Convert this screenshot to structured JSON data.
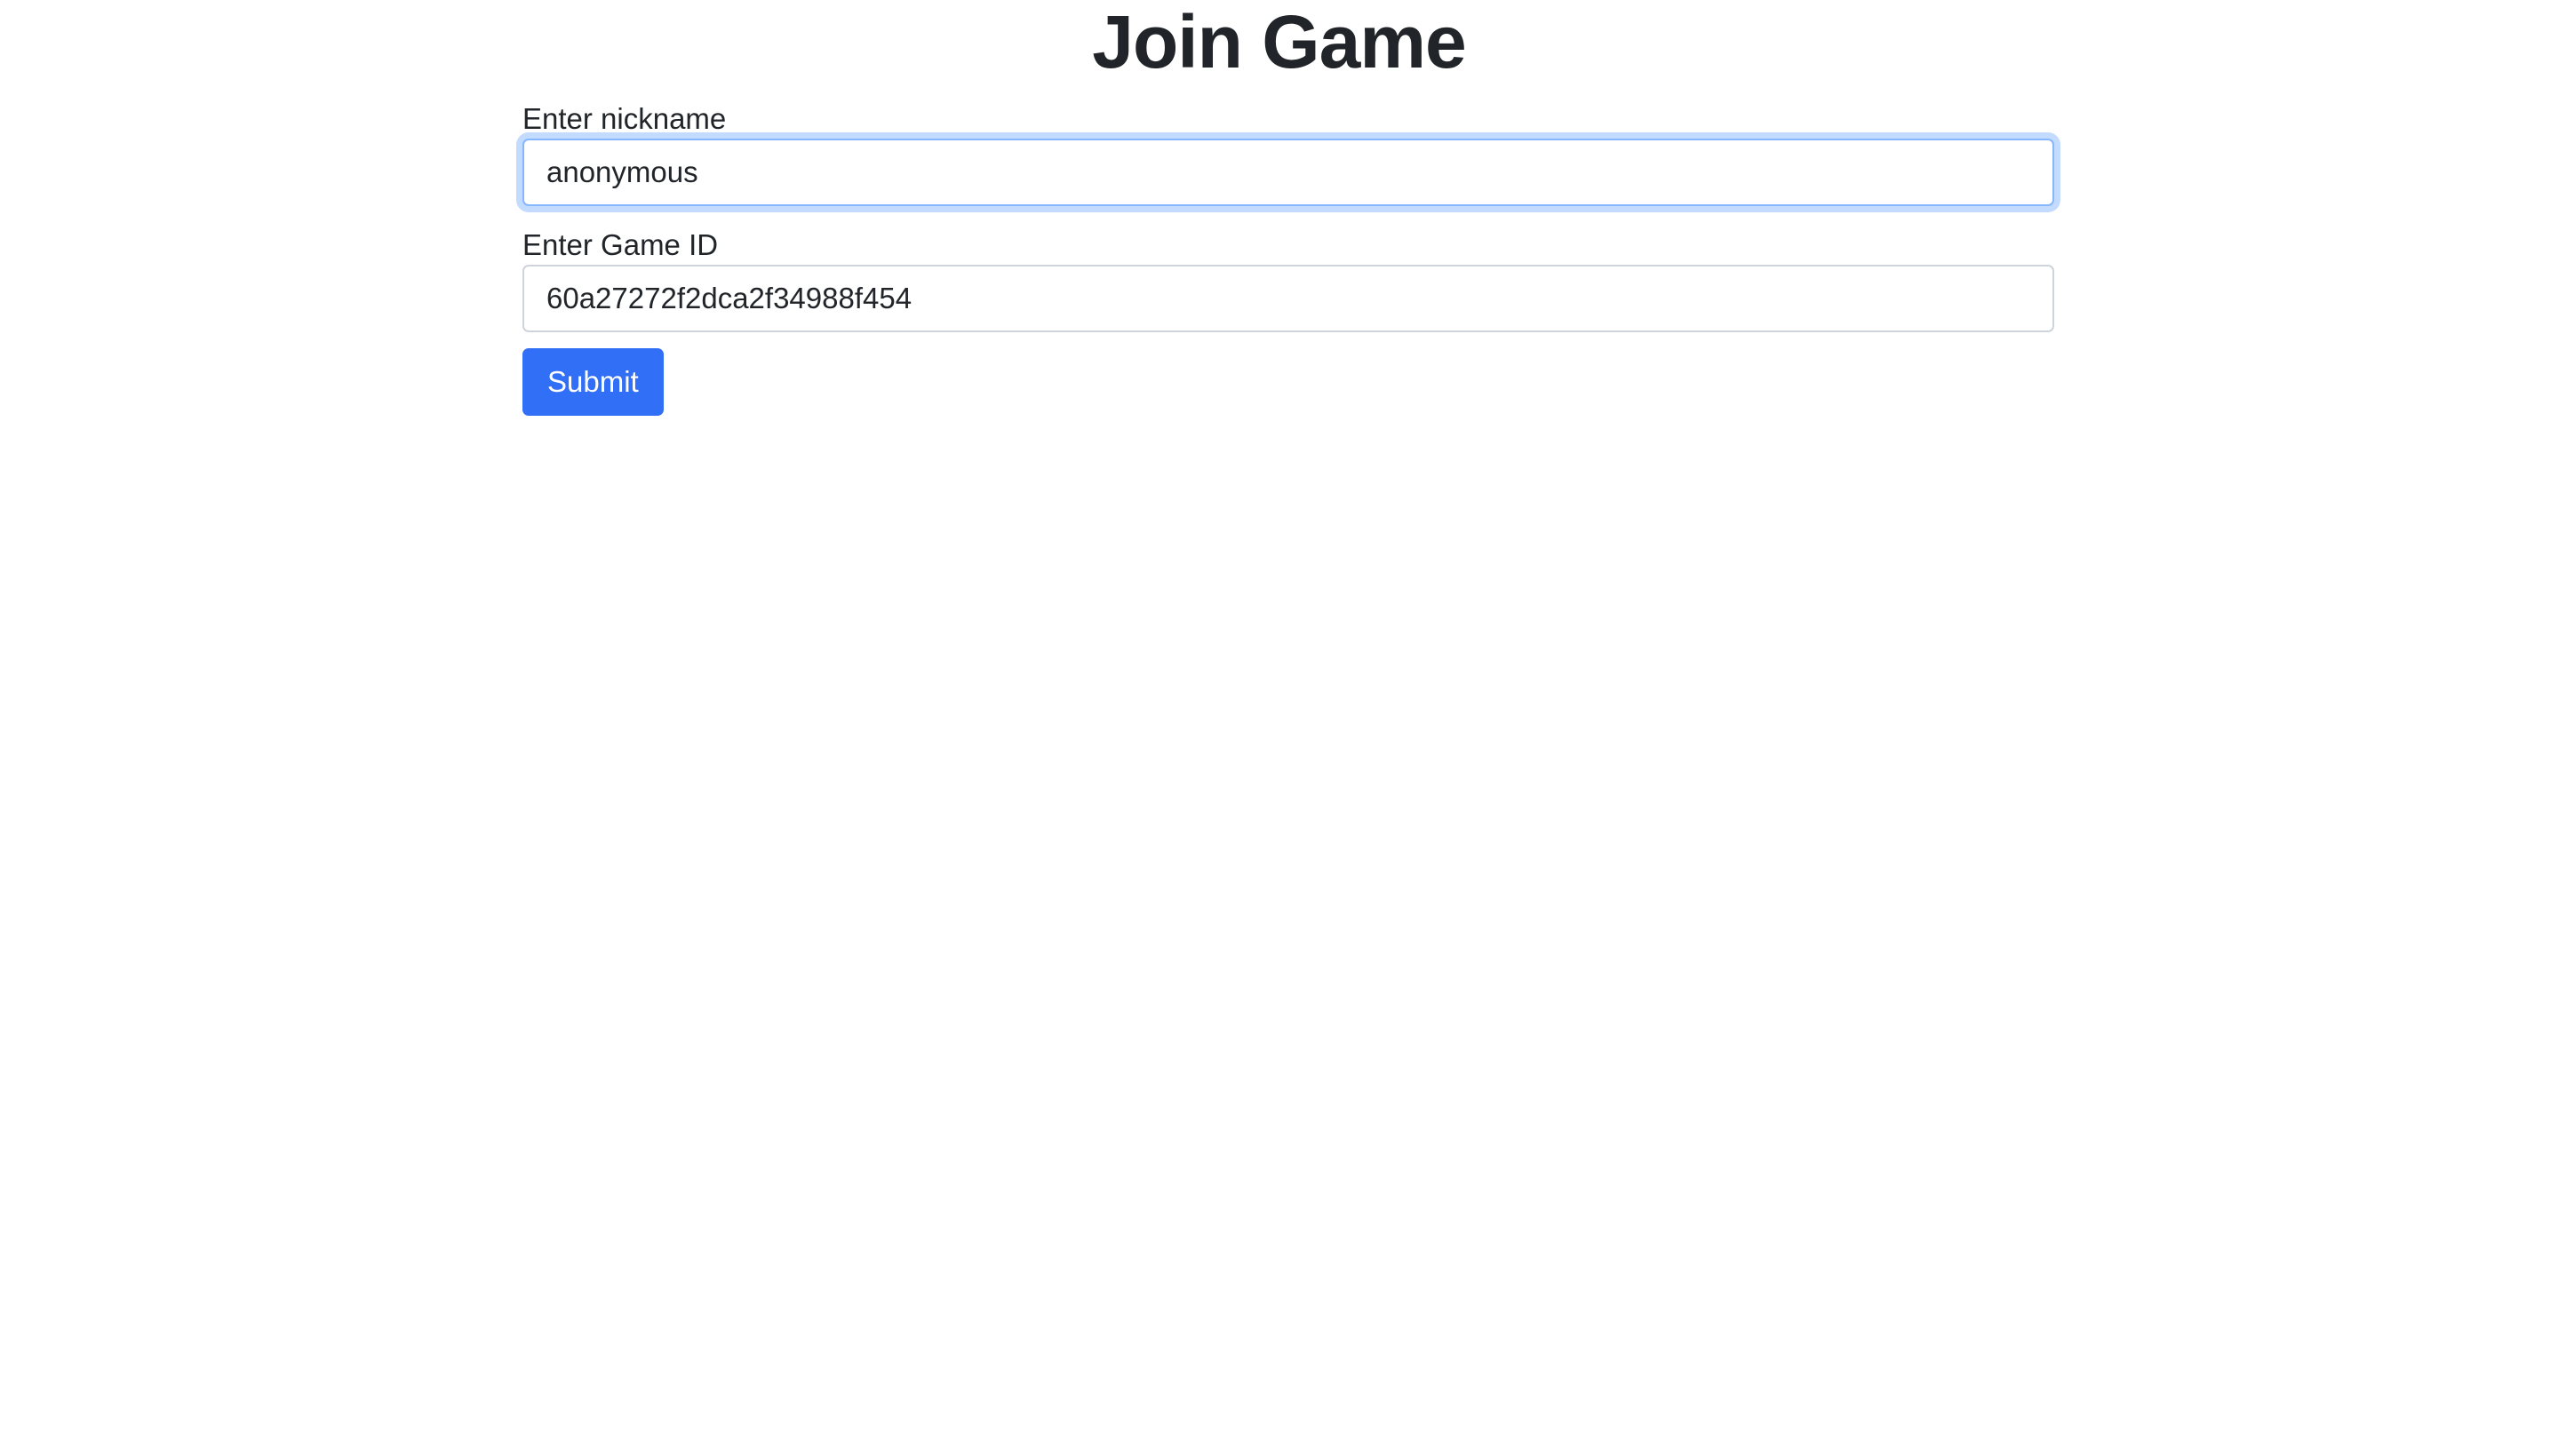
{
  "page": {
    "title": "Join Game"
  },
  "form": {
    "nickname": {
      "label": "Enter nickname",
      "value": "anonymous",
      "focused": true
    },
    "game_id": {
      "label": "Enter Game ID",
      "value": "60a27272f2dca2f34988f454"
    },
    "submit_label": "Submit"
  },
  "colors": {
    "accent": "#316ff6",
    "focus_border": "#86b7fe",
    "text": "#212529"
  }
}
